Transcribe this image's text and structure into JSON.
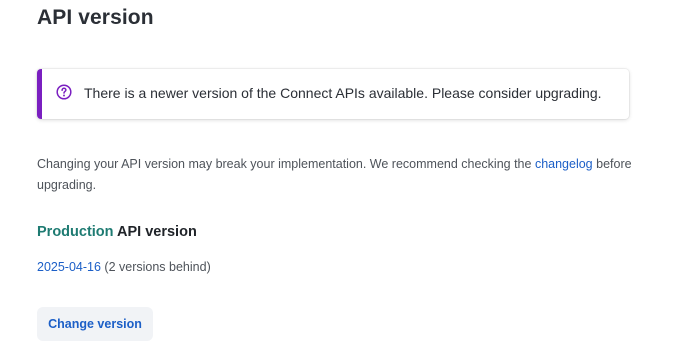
{
  "page": {
    "title": "API version"
  },
  "notice": {
    "icon": "question-circle-icon",
    "accent_color": "#7a1fc0",
    "text": "There is a newer version of the Connect APIs available. Please consider upgrading."
  },
  "description": {
    "text_before": "Changing your API version may break your implementation. We recommend checking the ",
    "link_text": "changelog",
    "text_after": " before upgrading."
  },
  "production": {
    "env_label": "Production",
    "heading_suffix": " API version",
    "version": "2025-04-16",
    "version_note": " (2 versions behind)",
    "button_label": "Change version"
  },
  "colors": {
    "link": "#1c5fc7",
    "env_label": "#1e7b72"
  }
}
